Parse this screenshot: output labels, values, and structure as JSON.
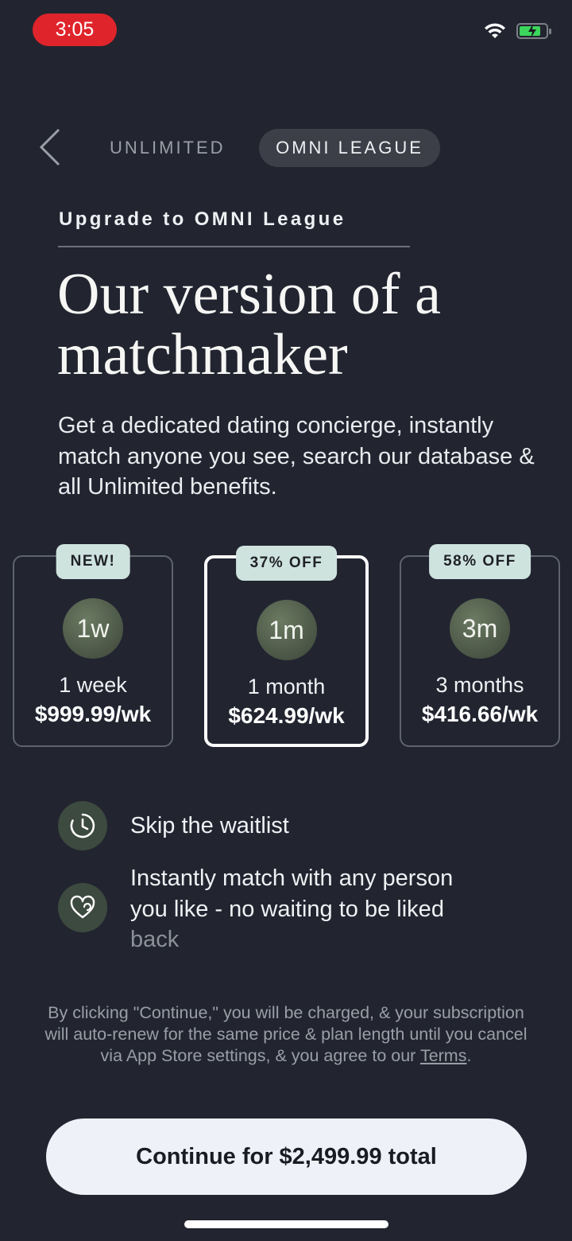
{
  "status_bar": {
    "time": "3:05"
  },
  "nav": {
    "tab_unlimited": "UNLIMITED",
    "tab_omni": "OMNI LEAGUE"
  },
  "header": {
    "kicker": "Upgrade to OMNI League",
    "headline_line1": "Our version of a",
    "headline_line2": "matchmaker",
    "subtitle": "Get a dedicated dating concierge, instantly match anyone you see, search our database & all Unlimited benefits."
  },
  "plans": [
    {
      "badge": "NEW!",
      "short": "1w",
      "name": "1 week",
      "price": "$999.99/wk",
      "selected": false
    },
    {
      "badge": "37% OFF",
      "short": "1m",
      "name": "1 month",
      "price": "$624.99/wk",
      "selected": true
    },
    {
      "badge": "58% OFF",
      "short": "3m",
      "name": "3 months",
      "price": "$416.66/wk",
      "selected": false
    }
  ],
  "features": [
    {
      "icon": "clock-icon",
      "text": "Skip the waitlist"
    },
    {
      "icon": "heart-icon",
      "text_line1": "Instantly match with any person",
      "text_line2": "you like - no waiting to be liked",
      "text_line3": "back"
    }
  ],
  "legal": {
    "text": "By clicking \"Continue,\" you will be charged, & your subscription will auto-renew for the same price & plan length until you cancel via App Store settings, & you agree to our ",
    "terms_link": "Terms",
    "end": "."
  },
  "cta": {
    "label": "Continue for $2,499.99 total"
  },
  "colors": {
    "background": "#222530",
    "badge": "#cfe3de",
    "cta": "#eef1f8",
    "status_pill": "#e0242b"
  }
}
